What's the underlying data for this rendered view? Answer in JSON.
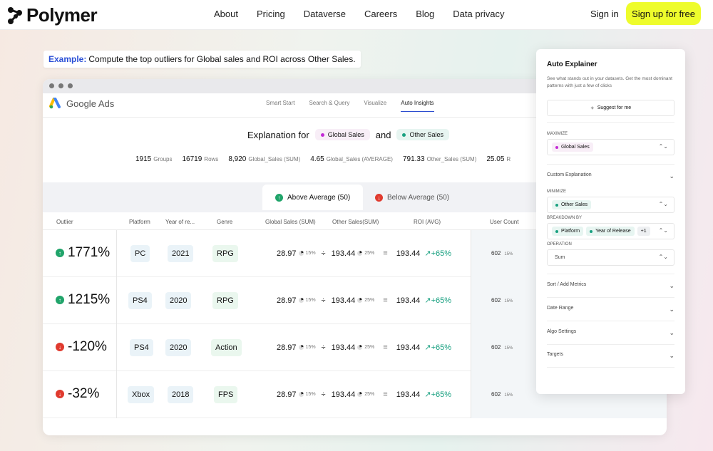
{
  "nav": {
    "logo_text": "Polymer",
    "menu": [
      "About",
      "Pricing",
      "Dataverse",
      "Careers",
      "Blog",
      "Data privacy"
    ],
    "sign_in": "Sign in",
    "sign_up": "Sign up for free"
  },
  "example": {
    "label": "Example:",
    "text": "Compute the top outliers for Global sales and ROI across Other Sales."
  },
  "app": {
    "brand": "Google Ads",
    "tabs": [
      "Smart Start",
      "Search & Query",
      "Visualize",
      "Auto Insights"
    ],
    "active_tab": "Auto Insights",
    "explanation": {
      "prefix": "Explanation for",
      "metric1": "Global Sales",
      "joiner": "and",
      "metric2": "Other Sales"
    },
    "stats": [
      {
        "value": "1915",
        "label": "Groups"
      },
      {
        "value": "16719",
        "label": "Rows"
      },
      {
        "value": "8,920",
        "label": "Global_Sales (SUM)"
      },
      {
        "value": "4.65",
        "label": "Global_Sales (AVERAGE)"
      },
      {
        "value": "791.33",
        "label": "Other_Sales (SUM)"
      },
      {
        "value": "25.05",
        "label": "R"
      }
    ],
    "avg_tabs": {
      "above": "Above Average (50)",
      "below": "Below Average (50)"
    },
    "columns": [
      "Outlier",
      "Platform",
      "Year of re...",
      "Genre",
      "Global Sales (SUM)",
      "Other Sales(SUM)",
      "ROI (AVG)",
      "User Count"
    ],
    "rows": [
      {
        "direction": "up",
        "outlier": "1771%",
        "platform": "PC",
        "year": "2021",
        "genre": "RPG",
        "global_sales": "28.97",
        "global_pct": "15%",
        "div": "÷",
        "other_sales": "193.44",
        "other_pct": "25%",
        "eq": "=",
        "roi": "193.44",
        "gain": "+65%",
        "user_count": "602",
        "user_pct": "15%"
      },
      {
        "direction": "up",
        "outlier": "1215%",
        "platform": "PS4",
        "year": "2020",
        "genre": "RPG",
        "global_sales": "28.97",
        "global_pct": "15%",
        "div": "÷",
        "other_sales": "193.44",
        "other_pct": "25%",
        "eq": "=",
        "roi": "193.44",
        "gain": "+65%",
        "user_count": "602",
        "user_pct": "15%"
      },
      {
        "direction": "down",
        "outlier": "-120%",
        "platform": "PS4",
        "year": "2020",
        "genre": "Action",
        "global_sales": "28.97",
        "global_pct": "15%",
        "div": "÷",
        "other_sales": "193.44",
        "other_pct": "25%",
        "eq": "=",
        "roi": "193.44",
        "gain": "+65%",
        "user_count": "602",
        "user_pct": "15%"
      },
      {
        "direction": "down",
        "outlier": "-32%",
        "platform": "Xbox",
        "year": "2018",
        "genre": "FPS",
        "global_sales": "28.97",
        "global_pct": "15%",
        "div": "÷",
        "other_sales": "193.44",
        "other_pct": "25%",
        "eq": "=",
        "roi": "193.44",
        "gain": "+65%",
        "user_count": "602",
        "user_pct": "15%"
      }
    ]
  },
  "panel": {
    "title": "Auto Explainer",
    "subtitle": "See what stands out in your datasets. Get the most dominant patterns with just a few of clicks",
    "suggest": "Suggest for me",
    "maximize_label": "MAXIMIZE",
    "maximize_value": "Global Sales",
    "custom_explanation": "Custom Explanation",
    "minimize_label": "MINIMIZE",
    "minimize_value": "Other Sales",
    "breakdown_label": "BREAKDOWN BY",
    "breakdown_values": [
      "Platform",
      "Year of Release"
    ],
    "breakdown_more": "+1",
    "operation_label": "OPERATION",
    "operation_value": "Sum",
    "sections": [
      "Sort / Add Metrics",
      "Date Range",
      "Algo Settings",
      "Targets"
    ]
  },
  "colors": {
    "brand_yellow": "#eefc2c",
    "accent_blue": "#2b4ccf",
    "up_green": "#20a46a",
    "down_red": "#e03a2e",
    "teal": "#18a080",
    "pink": "#c32ad6"
  }
}
